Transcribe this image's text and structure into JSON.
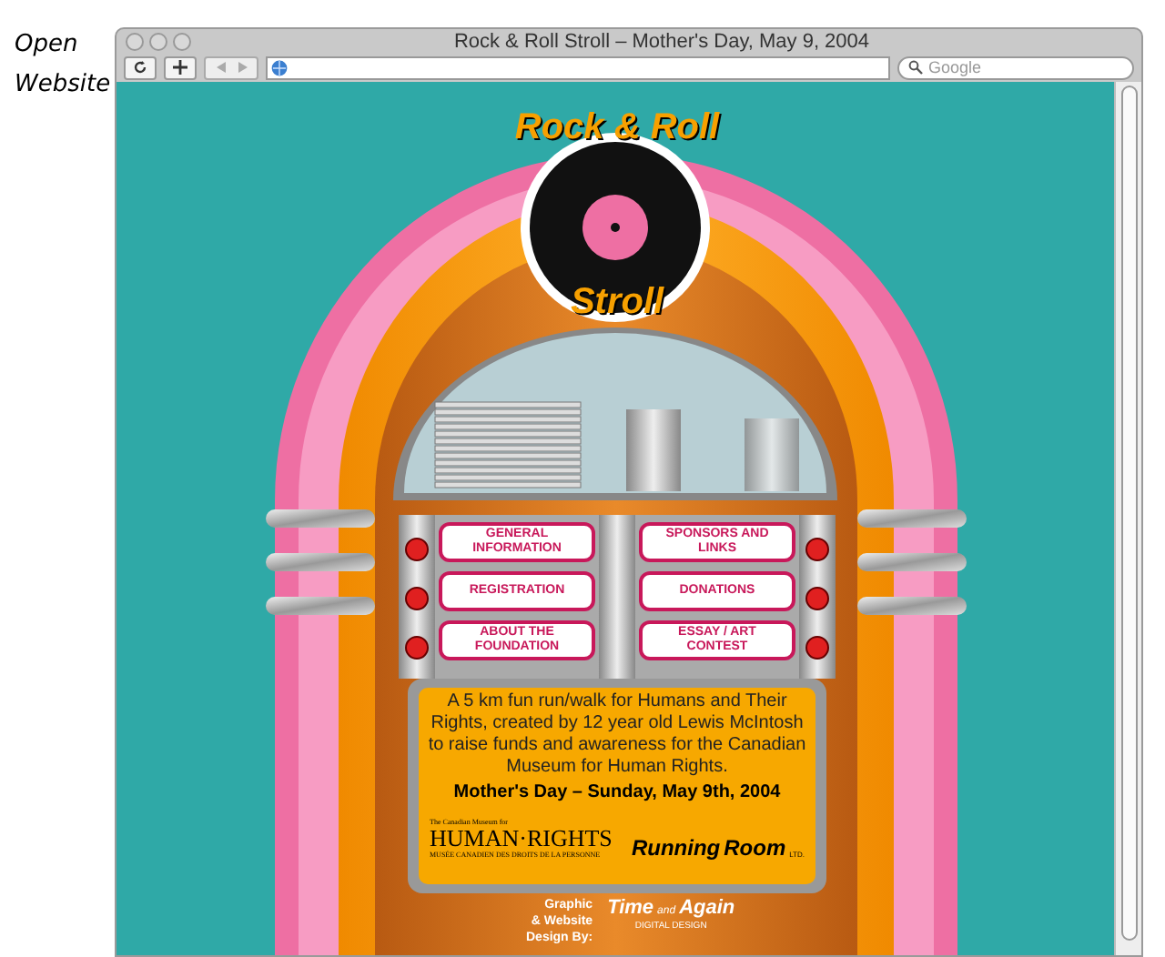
{
  "note": [
    "Open",
    "Website"
  ],
  "window": {
    "title": "Rock & Roll Stroll – Mother's Day, May 9, 2004"
  },
  "toolbar": {
    "search_placeholder": "Google"
  },
  "page": {
    "logo": {
      "top": "Rock & Roll",
      "bottom": "Stroll"
    },
    "menu": [
      {
        "label": "GENERAL INFORMATION"
      },
      {
        "label": "SPONSORS AND LINKS"
      },
      {
        "label": "REGISTRATION"
      },
      {
        "label": "DONATIONS"
      },
      {
        "label": "ABOUT THE FOUNDATION"
      },
      {
        "label": "ESSAY / ART CONTEST"
      }
    ],
    "description": "A 5 km fun run/walk for Humans and Their Rights, created by 12 year old Lewis McIntosh to raise funds and awareness for the Canadian Museum for Human Rights.",
    "date": "Mother's Day – Sunday, May 9th, 2004",
    "museum_logo": {
      "small": "The Canadian Museum for",
      "name": "HUMAN·RIGHTS",
      "french": "MUSÉE CANADIEN DES DROITS DE LA PERSONNE"
    },
    "running_logo": {
      "name": "Running",
      "name2": "Room",
      "suffix": "LTD."
    },
    "credit": {
      "lines": [
        "Graphic",
        "& Website",
        "Design By:"
      ],
      "logo": [
        "Time",
        "and",
        "Again"
      ],
      "logo_sub": "DIGITAL DESIGN"
    }
  }
}
